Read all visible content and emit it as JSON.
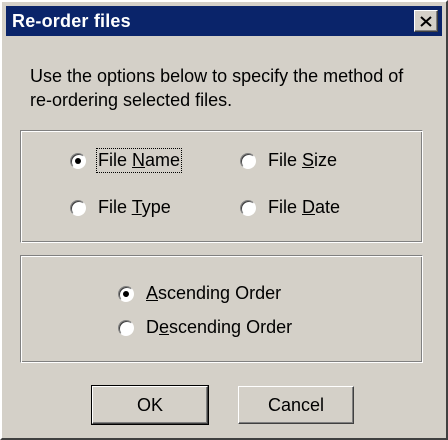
{
  "dialog": {
    "title": "Re-order files",
    "description_line1": "Use the options below to specify the method of",
    "description_line2": "re-ordering selected files."
  },
  "sort_by": {
    "file_name": {
      "pre": "File ",
      "key": "N",
      "post": "ame",
      "selected": true
    },
    "file_size": {
      "pre": "File ",
      "key": "S",
      "post": "ize",
      "selected": false
    },
    "file_type": {
      "pre": "File ",
      "key": "T",
      "post": "ype",
      "selected": false
    },
    "file_date": {
      "pre": "File ",
      "key": "D",
      "post": "ate",
      "selected": false
    }
  },
  "order": {
    "ascending": {
      "pre": "",
      "key": "A",
      "post": "scending Order",
      "selected": true
    },
    "descending": {
      "pre": "D",
      "key": "e",
      "post": "scending Order",
      "selected": false
    }
  },
  "buttons": {
    "ok": "OK",
    "cancel": "Cancel"
  },
  "icons": {
    "close": "close-icon",
    "radio": "radio-button"
  },
  "colors": {
    "titlebar": "#0a246a",
    "face": "#d4d0c8"
  }
}
